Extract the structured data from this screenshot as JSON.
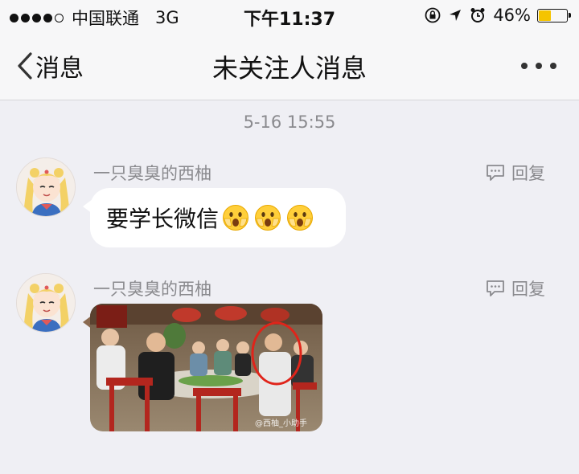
{
  "status_bar": {
    "carrier": "中国联通",
    "network": "3G",
    "time": "下午11:37",
    "battery_percent_text": "46%",
    "battery_level": 0.46,
    "battery_color": "#f5c400"
  },
  "nav": {
    "back_label": "消息",
    "title": "未关注人消息"
  },
  "conversation": {
    "timestamp": "5-16 15:55",
    "messages": [
      {
        "sender": "一只臭臭的西柚",
        "reply_label": "回复",
        "text": "要学长微信",
        "emoji_count": 3,
        "emoji_icon": "scared-face-icon"
      },
      {
        "sender": "一只臭臭的西柚",
        "reply_label": "回复",
        "photo_watermark": "@西柚_小助手"
      }
    ]
  },
  "colors": {
    "background": "#efeff4",
    "bubble": "#ffffff",
    "secondary_text": "#8a8a8e"
  }
}
